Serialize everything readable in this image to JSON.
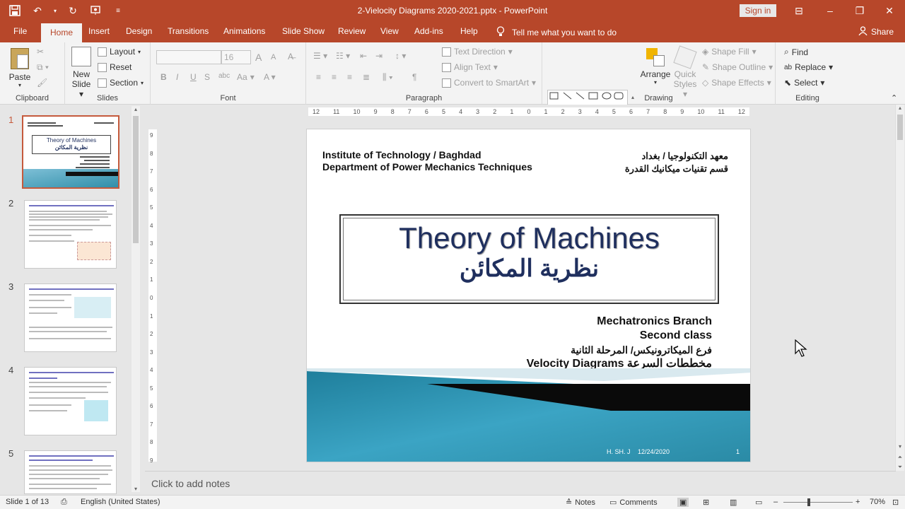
{
  "window": {
    "title": "2-Vielocity Diagrams 2020-2021.pptx  -  PowerPoint",
    "signin": "Sign in"
  },
  "tabs": [
    "File",
    "Home",
    "Insert",
    "Design",
    "Transitions",
    "Animations",
    "Slide Show",
    "Review",
    "View",
    "Add-ins",
    "Help"
  ],
  "tellme": "Tell me what you want to do",
  "share": "Share",
  "ribbon": {
    "clipboard": {
      "paste": "Paste",
      "label": "Clipboard"
    },
    "slides": {
      "new_slide": "New",
      "new_slide2": "Slide",
      "layout": "Layout",
      "reset": "Reset",
      "section": "Section",
      "label": "Slides"
    },
    "font": {
      "size": "16",
      "bold": "B",
      "italic": "I",
      "underline": "U",
      "strike": "S",
      "spacing": "abc",
      "case": "Aa",
      "grow": "A",
      "shrink": "A",
      "label": "Font"
    },
    "paragraph": {
      "text_direction": "Text Direction",
      "align_text": "Align Text",
      "smartart": "Convert to SmartArt",
      "label": "Paragraph"
    },
    "drawing": {
      "arrange": "Arrange",
      "quick": "Quick",
      "styles": "Styles",
      "fill": "Shape Fill",
      "outline": "Shape Outline",
      "effects": "Shape Effects",
      "label": "Drawing"
    },
    "editing": {
      "find": "Find",
      "replace": "Replace",
      "select": "Select",
      "label": "Editing"
    }
  },
  "thumbnails": [
    {
      "num": "1",
      "title": "Theory of Machines",
      "ar": "نظرية المكائن"
    },
    {
      "num": "2"
    },
    {
      "num": "3"
    },
    {
      "num": "4"
    },
    {
      "num": "5"
    }
  ],
  "ruler": {
    "h": [
      "12",
      "11",
      "10",
      "9",
      "8",
      "7",
      "6",
      "5",
      "4",
      "3",
      "2",
      "1",
      "0",
      "1",
      "2",
      "3",
      "4",
      "5",
      "6",
      "7",
      "8",
      "9",
      "10",
      "11",
      "12"
    ],
    "v": [
      "9",
      "8",
      "7",
      "6",
      "5",
      "4",
      "3",
      "2",
      "1",
      "0",
      "1",
      "2",
      "3",
      "4",
      "5",
      "6",
      "7",
      "8",
      "9"
    ]
  },
  "slide": {
    "inst_line1": "Institute of Technology / Baghdad",
    "inst_line2": "Department  of Power Mechanics Techniques",
    "inst_ar1": "معهد التكنولوجيا / بغداد",
    "inst_ar2": "قسم تقنيات ميكانيك القدرة",
    "title_en": "Theory of Machines",
    "title_ar": "نظرية المكائن",
    "branch1": "Mechatronics Branch",
    "branch2": "Second class",
    "branch_ar": "فرع الميكاترونيكس/ المرحلة الثانية",
    "topic": "Velocity Diagrams مخططات السرعة",
    "footer_author": "H. SH. J",
    "footer_date": "12/24/2020",
    "footer_page": "1"
  },
  "notes_placeholder": "Click to add notes",
  "status": {
    "slide": "Slide 1 of 13",
    "language": "English (United States)",
    "notes": "Notes",
    "comments": "Comments",
    "zoom": "70%"
  },
  "colors": {
    "accent": "#b7472a",
    "slide_teal": "#2a8aa5",
    "title_blue": "#1f2f5e"
  }
}
